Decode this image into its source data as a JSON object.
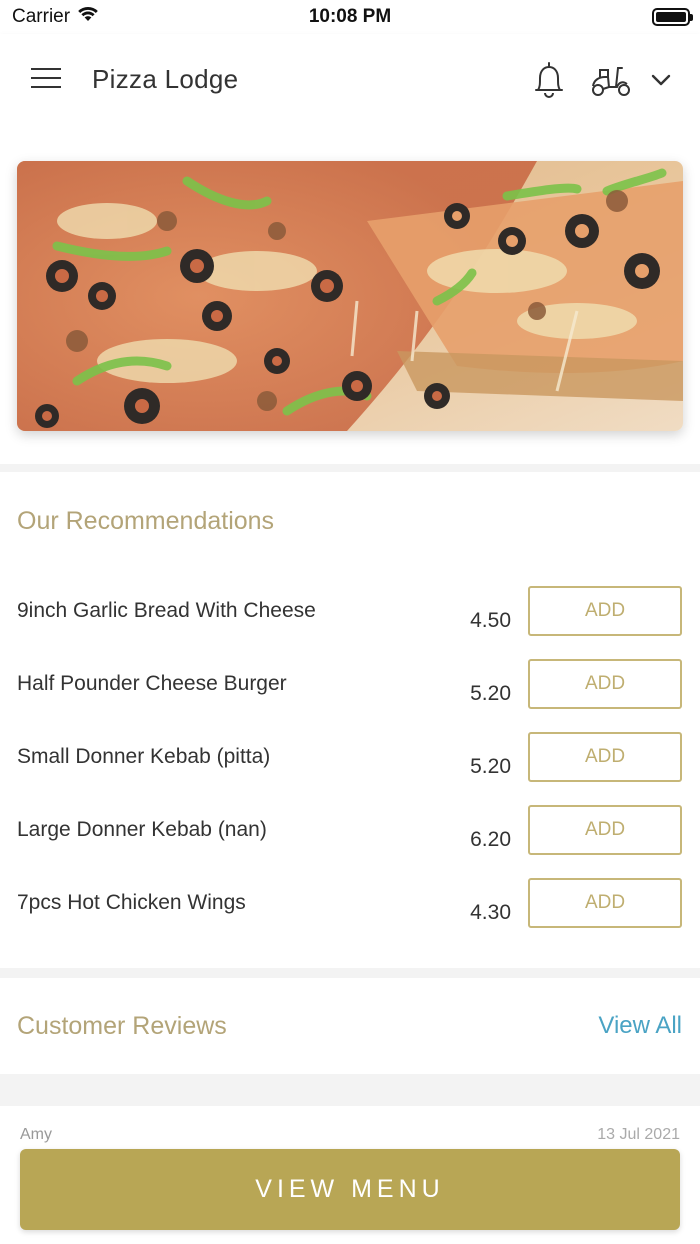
{
  "status_bar": {
    "carrier": "Carrier",
    "time": "10:08 PM"
  },
  "header": {
    "title": "Pizza Lodge",
    "icons": [
      "menu-icon",
      "bell-icon",
      "scooter-icon",
      "chevron-down-icon"
    ]
  },
  "hero": {
    "image": "pizza-banner"
  },
  "recommendations": {
    "title": "Our Recommendations",
    "items": [
      {
        "name": "9inch Garlic Bread With Cheese",
        "price": "4.50",
        "button": "ADD"
      },
      {
        "name": "Half Pounder Cheese Burger",
        "price": "5.20",
        "button": "ADD"
      },
      {
        "name": "Small Donner Kebab (pitta)",
        "price": "5.20",
        "button": "ADD"
      },
      {
        "name": "Large Donner Kebab (nan)",
        "price": "6.20",
        "button": "ADD"
      },
      {
        "name": "7pcs Hot Chicken Wings",
        "price": "4.30",
        "button": "ADD"
      }
    ]
  },
  "reviews": {
    "title": "Customer Reviews",
    "view_all": "View All",
    "first_review": {
      "name": "Amy",
      "date": "13 Jul 2021"
    }
  },
  "footer": {
    "view_menu": "VIEW MENU"
  },
  "colors": {
    "accent_gold": "#b8a655",
    "section_title": "#b3a478",
    "link_blue": "#4aa3c4"
  }
}
